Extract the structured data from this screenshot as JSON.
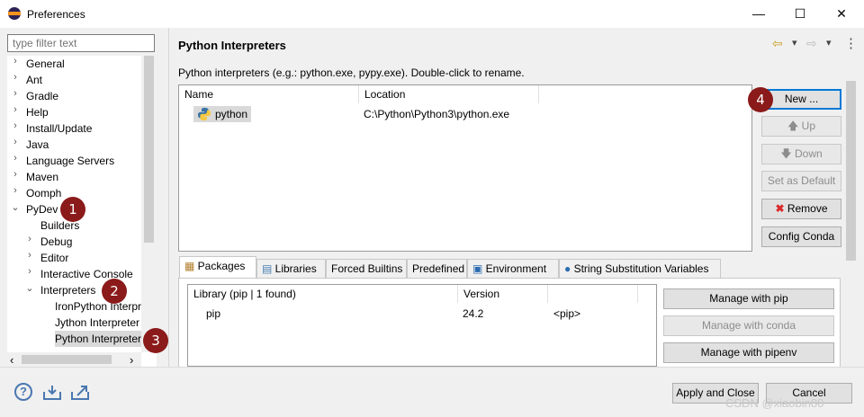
{
  "window": {
    "title": "Preferences",
    "controls": {
      "minimize": "—",
      "maximize": "☐",
      "close": "✕"
    }
  },
  "sidebar": {
    "filter_placeholder": "type filter text",
    "items": [
      {
        "label": "General",
        "indent": 0,
        "expander": "›"
      },
      {
        "label": "Ant",
        "indent": 0,
        "expander": "›"
      },
      {
        "label": "Gradle",
        "indent": 0,
        "expander": "›"
      },
      {
        "label": "Help",
        "indent": 0,
        "expander": "›"
      },
      {
        "label": "Install/Update",
        "indent": 0,
        "expander": "›"
      },
      {
        "label": "Java",
        "indent": 0,
        "expander": "›"
      },
      {
        "label": "Language Servers",
        "indent": 0,
        "expander": "›"
      },
      {
        "label": "Maven",
        "indent": 0,
        "expander": "›"
      },
      {
        "label": "Oomph",
        "indent": 0,
        "expander": "›"
      },
      {
        "label": "PyDev",
        "indent": 0,
        "expander": "⌄"
      },
      {
        "label": "Builders",
        "indent": 1,
        "expander": ""
      },
      {
        "label": "Debug",
        "indent": 1,
        "expander": "›"
      },
      {
        "label": "Editor",
        "indent": 1,
        "expander": "›"
      },
      {
        "label": "Interactive Console",
        "indent": 1,
        "expander": "›"
      },
      {
        "label": "Interpreters",
        "indent": 1,
        "expander": "⌄"
      },
      {
        "label": "IronPython Interpr",
        "indent": 2,
        "expander": ""
      },
      {
        "label": "Jython Interpreter",
        "indent": 2,
        "expander": ""
      },
      {
        "label": "Python Interpreter",
        "indent": 2,
        "expander": ""
      }
    ],
    "scroll_left": "‹",
    "scroll_right": "›"
  },
  "header": {
    "title": "Python Interpreters",
    "back_icon": "⇦",
    "forward_icon": "⇨",
    "dropdown": "▾",
    "menu": "⋮"
  },
  "interpreters": {
    "description": "Python interpreters (e.g.: python.exe, pypy.exe).   Double-click to rename.",
    "columns": [
      "Name",
      "Location"
    ],
    "rows": [
      {
        "name": "python",
        "location": "C:\\Python\\Python3\\python.exe"
      }
    ]
  },
  "buttons": {
    "new": "New ...",
    "up": "Up",
    "down": "Down",
    "set_default": "Set as Default",
    "remove": "Remove",
    "config_conda": "Config Conda"
  },
  "tabs": [
    {
      "label": "Packages"
    },
    {
      "label": "Libraries"
    },
    {
      "label": "Forced Builtins"
    },
    {
      "label": "Predefined"
    },
    {
      "label": "Environment"
    },
    {
      "label": "String Substitution Variables"
    }
  ],
  "packages": {
    "columns": [
      "Library (pip | 1 found)",
      "Version",
      ""
    ],
    "rows": [
      {
        "library": "pip",
        "version": "24.2",
        "installer": "<pip>"
      }
    ],
    "manage_pip": "Manage with pip",
    "manage_conda": "Manage with conda",
    "manage_pipenv": "Manage with pipenv"
  },
  "footer": {
    "apply_close": "Apply and Close",
    "cancel": "Cancel",
    "watermark": "CSDN @xiaobin80"
  },
  "badges": [
    "1",
    "2",
    "3",
    "4"
  ],
  "colors": {
    "badge": "#8b1a1a",
    "selection": "#d9d9d9",
    "accent": "#0078d7"
  }
}
